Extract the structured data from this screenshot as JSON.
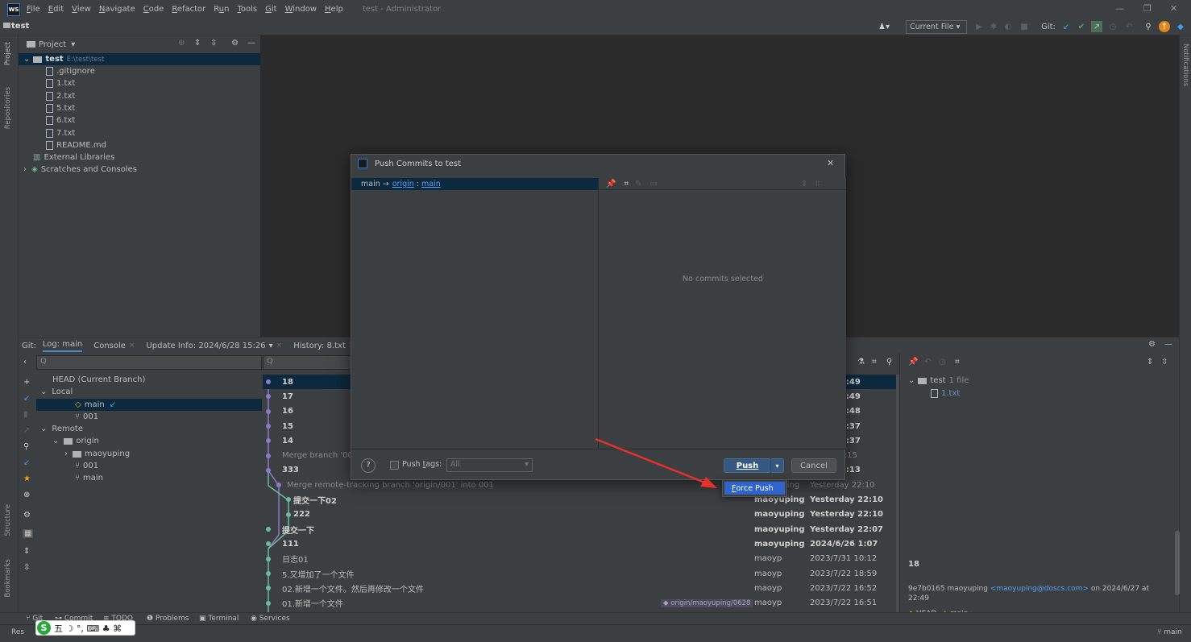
{
  "menubar": {
    "logo": "WS",
    "items": [
      {
        "pre": "",
        "u": "F",
        "post": "ile"
      },
      {
        "pre": "",
        "u": "E",
        "post": "dit"
      },
      {
        "pre": "",
        "u": "V",
        "post": "iew"
      },
      {
        "pre": "",
        "u": "N",
        "post": "avigate"
      },
      {
        "pre": "",
        "u": "C",
        "post": "ode"
      },
      {
        "pre": "",
        "u": "R",
        "post": "efactor"
      },
      {
        "pre": "R",
        "u": "u",
        "post": "n"
      },
      {
        "pre": "",
        "u": "T",
        "post": "ools"
      },
      {
        "pre": "",
        "u": "G",
        "post": "it"
      },
      {
        "pre": "",
        "u": "W",
        "post": "indow"
      },
      {
        "pre": "",
        "u": "H",
        "post": "elp"
      }
    ],
    "title": "test - Administrator"
  },
  "navbar": {
    "project": "test",
    "run_config": "Current File",
    "git_label": "Git:"
  },
  "left_stripe": {
    "project": "Project",
    "repositories": "Repositories",
    "structure": "Structure",
    "bookmarks": "Bookmarks"
  },
  "right_stripe": {
    "notifications": "Notifications"
  },
  "project_panel": {
    "header": "Project",
    "root": {
      "name": "test",
      "path": "E:\\test\\test"
    },
    "files": [
      ".gitignore",
      "1.txt",
      "2.txt",
      "5.txt",
      "6.txt",
      "7.txt",
      "README.md"
    ],
    "external": "External Libraries",
    "scratches": "Scratches and Consoles"
  },
  "git_panel": {
    "label": "Git:",
    "tabs": [
      {
        "label": "Log: main",
        "closable": false
      },
      {
        "label": "Console",
        "closable": true
      },
      {
        "label": "Update Info: 2024/6/28 15:26",
        "closable": true
      },
      {
        "label": "History: 8.txt",
        "closable": true
      }
    ],
    "search_placeholder": "Q",
    "branches": {
      "head": "HEAD (Current Branch)",
      "local": "Local",
      "local_items": [
        "main",
        "001"
      ],
      "remote": "Remote",
      "origin": "origin",
      "origin_items": [
        "maoyuping",
        "001",
        "main"
      ]
    },
    "log": [
      {
        "msg": "18",
        "author": "",
        "date": "y 22:49",
        "bold": true,
        "sel": true
      },
      {
        "msg": "17",
        "author": "",
        "date": "y 22:49",
        "bold": true
      },
      {
        "msg": "16",
        "author": "",
        "date": "y 22:48",
        "bold": true
      },
      {
        "msg": "15",
        "author": "",
        "date": "y 22:37",
        "bold": true
      },
      {
        "msg": "14",
        "author": "",
        "date": "y 22:37",
        "bold": true
      },
      {
        "msg": "Merge branch '001",
        "author": "",
        "date": "y 22:15",
        "dim": true
      },
      {
        "msg": "333",
        "author": "",
        "date": "y 22:13",
        "bold": true
      },
      {
        "msg": "Merge remote-tracking branch 'origin/001' into 001",
        "author": "maoyuping",
        "date": "Yesterday 22:10",
        "dim": true
      },
      {
        "msg": "提交一下02",
        "author": "maoyuping",
        "date": "Yesterday 22:10",
        "bold": true
      },
      {
        "msg": "222",
        "author": "maoyuping",
        "date": "Yesterday 22:10",
        "bold": true
      },
      {
        "msg": "提交一下",
        "author": "maoyuping",
        "date": "Yesterday 22:07",
        "bold": true
      },
      {
        "msg": "111",
        "author": "maoyuping",
        "date": "2024/6/26 1:07",
        "bold": true
      },
      {
        "msg": "日志01",
        "author": "maoyp",
        "date": "2023/7/31 10:12"
      },
      {
        "msg": "5.又增加了一个文件",
        "author": "maoyp",
        "date": "2023/7/22 18:59"
      },
      {
        "msg": "02.新增一个文件。然后再修改一个文件",
        "author": "maoyp",
        "date": "2023/7/22 16:52"
      },
      {
        "msg": "01.新增一个文件",
        "author": "maoyp",
        "date": "2023/7/22 16:51",
        "tag": "origin/maoyuping/0628"
      }
    ],
    "details": {
      "tree_root": "test",
      "tree_count": "1 file",
      "tree_file": "1.txt",
      "commit_title": "18",
      "hash_author": "9e7b0165 maoyuping",
      "email": "<maoyuping@doscs.com>",
      "on_date": "on 2024/6/27 at",
      "time": "22:49",
      "refs": [
        "HEAD",
        "main"
      ]
    }
  },
  "dialog": {
    "title": "Push Commits to test",
    "spec_local": "main →",
    "spec_remote": "origin",
    "spec_sep": ":",
    "spec_branch": "main",
    "no_commits": "No commits selected",
    "push_tags_pre": "Push ",
    "push_tags_u": "t",
    "push_tags_post": "ags:",
    "tags_value": "All",
    "push_label": "Push",
    "cancel_label": "Cancel",
    "force_push_u": "F",
    "force_push_rest": "orce Push"
  },
  "bottom_tabs": {
    "git": "Git",
    "commit": "Commit",
    "todo": "TODO",
    "problems": "Problems",
    "terminal": "Terminal",
    "services": "Services"
  },
  "status": {
    "left": "Res",
    "branch": "main"
  },
  "ime": {
    "glyphs": "五 ☽ °, ⌨ ♣ ⌘"
  },
  "colors": {
    "accent": "#4a88c7",
    "selection": "#0d293e",
    "popup_highlight": "#2f65ca",
    "arrow": "#e8302a",
    "graph_purple": "#8b7bc7",
    "graph_teal": "#6cb8a0"
  }
}
